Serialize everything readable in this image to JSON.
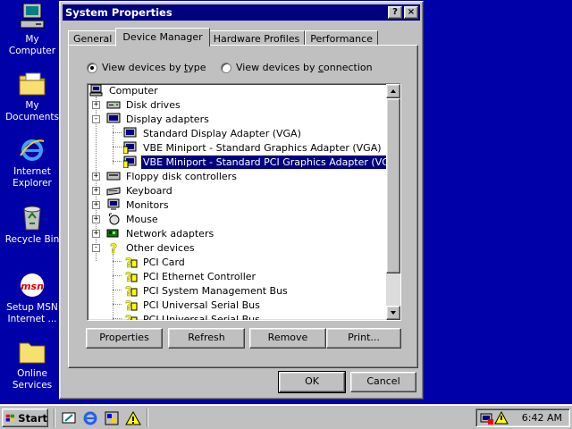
{
  "desktop": {
    "icons": [
      {
        "label": "My Computer"
      },
      {
        "label": "My Documents"
      },
      {
        "label": "Internet Explorer"
      },
      {
        "label": "Recycle Bin"
      },
      {
        "label": "Setup MSN Internet ..."
      },
      {
        "label": "Online Services"
      }
    ]
  },
  "window": {
    "title": "System Properties",
    "help_btn": "?",
    "close_btn": "×",
    "tabs": [
      "General",
      "Device Manager",
      "Hardware Profiles",
      "Performance"
    ],
    "radio_type": {
      "prefix": "View devices by ",
      "key": "t",
      "suffix": "ype"
    },
    "radio_connection": {
      "prefix": "View devices by ",
      "key": "c",
      "suffix": "onnection"
    },
    "tree": [
      {
        "label": "Computer"
      },
      {
        "label": "Disk drives"
      },
      {
        "label": "Display adapters"
      },
      {
        "label": "Standard Display Adapter (VGA)"
      },
      {
        "label": "VBE Miniport - Standard Graphics Adapter (VGA)"
      },
      {
        "label": "VBE Miniport - Standard PCI Graphics Adapter (VGA)"
      },
      {
        "label": "Floppy disk controllers"
      },
      {
        "label": "Keyboard"
      },
      {
        "label": "Monitors"
      },
      {
        "label": "Mouse"
      },
      {
        "label": "Network adapters"
      },
      {
        "label": "Other devices"
      },
      {
        "label": "PCI Card"
      },
      {
        "label": "PCI Ethernet Controller"
      },
      {
        "label": "PCI System Management Bus"
      },
      {
        "label": "PCI Universal Serial Bus"
      },
      {
        "label": "PCI Universal Serial Bus"
      }
    ],
    "buttons": {
      "properties": "Properties",
      "refresh": "Refresh",
      "remove": "Remove",
      "print": "Print...",
      "ok": "OK",
      "cancel": "Cancel"
    }
  },
  "taskbar": {
    "start": "Start",
    "clock": "6:42 AM"
  },
  "colors": {
    "desktop": "#0000a8",
    "titlebar": "#000080",
    "face": "#c0c0c0"
  }
}
